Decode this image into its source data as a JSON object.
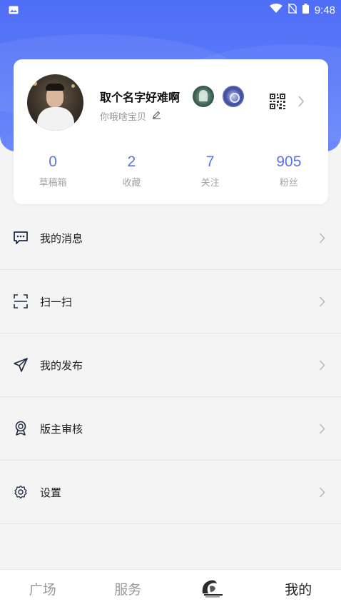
{
  "status_bar": {
    "time": "9:48"
  },
  "profile": {
    "name": "取个名字好难啊",
    "bio": "你哦啥宝贝",
    "stats": [
      {
        "value": "0",
        "label": "草稿箱"
      },
      {
        "value": "2",
        "label": "收藏"
      },
      {
        "value": "7",
        "label": "关注"
      },
      {
        "value": "905",
        "label": "粉丝"
      }
    ]
  },
  "menu": {
    "items": [
      {
        "label": "我的消息",
        "icon": "message-icon"
      },
      {
        "label": "扫一扫",
        "icon": "scan-icon"
      },
      {
        "label": "我的发布",
        "icon": "send-icon"
      },
      {
        "label": "版主审核",
        "icon": "award-icon"
      },
      {
        "label": "设置",
        "icon": "gear-icon"
      }
    ]
  },
  "tab_bar": {
    "tabs": [
      {
        "label": "广场"
      },
      {
        "label": "服务"
      },
      {
        "label": ""
      },
      {
        "label": "我的"
      }
    ],
    "active_index": 3
  },
  "colors": {
    "header_blue": "#5b7bf8",
    "stat_number": "#5a74e8",
    "background": "#f4f4f4"
  }
}
